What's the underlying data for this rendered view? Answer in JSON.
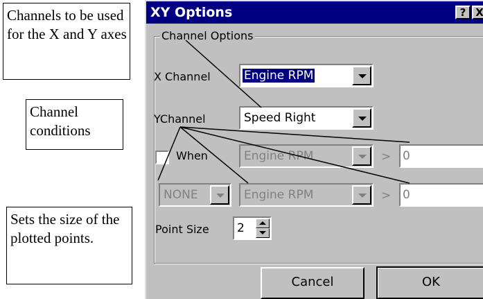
{
  "callouts": {
    "axes": "Channels to be used for the X and Y axes",
    "conditions": "Channel conditions",
    "point_size": "Sets the size of the plotted points."
  },
  "dialog": {
    "title": "XY Options",
    "help_button": "?",
    "close_button": "X",
    "group_label": "Channel Options",
    "x_channel": {
      "label": "X Channel",
      "value": "Engine RPM"
    },
    "y_channel": {
      "label": "YChannel",
      "value": "Speed Right"
    },
    "when": {
      "label": "When",
      "checked": false,
      "channel": "Engine RPM",
      "operator": ">",
      "value": "0"
    },
    "condition2": {
      "logic": "NONE",
      "channel": "Engine RPM",
      "operator": ">",
      "value": "0"
    },
    "point_size": {
      "label": "Point Size",
      "value": "2"
    },
    "cancel_label": "Cancel",
    "ok_label": "OK"
  },
  "colors": {
    "titlebar": "#000080",
    "face": "#c0c0c0",
    "selection": "#000080"
  }
}
